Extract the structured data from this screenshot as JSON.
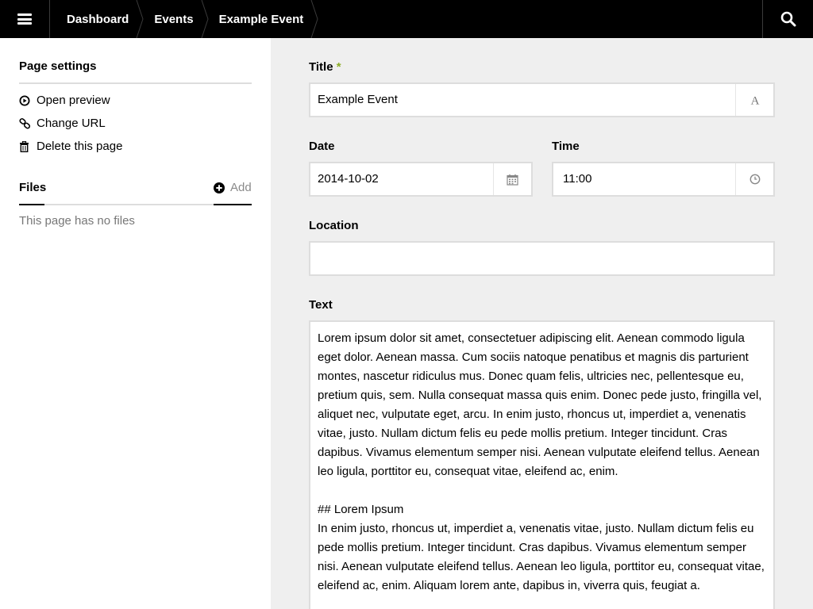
{
  "topbar": {
    "breadcrumbs": [
      "Dashboard",
      "Events",
      "Example Event"
    ],
    "icons": {
      "menu": "hamburger-icon",
      "search": "search-icon"
    }
  },
  "sidebar": {
    "page_settings_title": "Page settings",
    "links": [
      {
        "label": "Open preview",
        "icon": "play-circle-icon"
      },
      {
        "label": "Change URL",
        "icon": "link-icon"
      },
      {
        "label": "Delete this page",
        "icon": "trash-icon"
      }
    ],
    "files_title": "Files",
    "add_label": "Add",
    "no_files_text": "This page has no files"
  },
  "form": {
    "title": {
      "label": "Title",
      "required_mark": "*",
      "value": "Example Event",
      "icon": "font-icon"
    },
    "date": {
      "label": "Date",
      "value": "2014-10-02",
      "icon": "calendar-icon"
    },
    "time": {
      "label": "Time",
      "value": "11:00",
      "icon": "clock-icon"
    },
    "location": {
      "label": "Location",
      "value": ""
    },
    "text": {
      "label": "Text",
      "paragraph1": "Lorem ipsum dolor sit amet, consectetuer adipiscing elit. Aenean commodo ligula eget dolor. Aenean massa. Cum sociis natoque penatibus et magnis dis parturient montes, nascetur ridiculus mus. Donec quam felis, ultricies nec, pellentesque eu, pretium quis, sem. Nulla consequat massa quis enim. Donec pede justo, fringilla vel, aliquet nec, vulputate eget, arcu. In enim justo, rhoncus ut, imperdiet a, venenatis vitae, justo. Nullam dictum felis eu pede mollis pretium. Integer tincidunt. Cras dapibus. Vivamus elementum semper nisi. Aenean vulputate eleifend tellus. Aenean leo ligula, porttitor eu, consequat vitae, eleifend ac, enim.",
      "heading": "## Lorem Ipsum",
      "paragraph2": "In enim justo, rhoncus ut, imperdiet a, venenatis vitae, justo. Nullam dictum felis eu pede mollis pretium. Integer tincidunt. Cras dapibus. Vivamus elementum semper nisi. Aenean vulputate eleifend tellus. Aenean leo ligula, porttitor eu, consequat vitae, eleifend ac, enim. Aliquam lorem ante, dapibus in, viverra quis, feugiat a."
    }
  },
  "colors": {
    "topbar": "#000000",
    "required": "#8dae28",
    "field_border": "#dddddd",
    "main_bg": "#efefef"
  }
}
